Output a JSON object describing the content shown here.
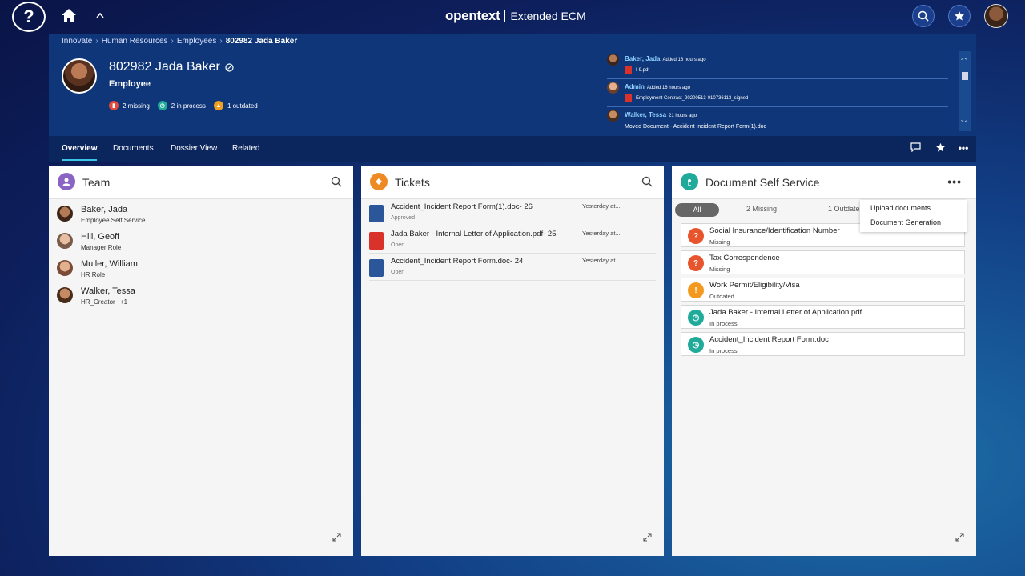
{
  "topbar": {
    "help_label": "?",
    "brand_logo": "opentext",
    "brand_product": "Extended ECM"
  },
  "breadcrumb": [
    "Innovate",
    "Human Resources",
    "Employees",
    "802982 Jada Baker"
  ],
  "person": {
    "name": "802982 Jada Baker",
    "role": "Employee",
    "status": [
      {
        "label": "2 missing",
        "color": "#e04a3a",
        "icon": "missing-icon"
      },
      {
        "label": "2 in process",
        "color": "#1faa9a",
        "icon": "clock-icon"
      },
      {
        "label": "1 outdated",
        "color": "#f0a020",
        "icon": "warning-icon"
      }
    ]
  },
  "activity": [
    {
      "who": "Baker, Jada",
      "when": "Added 16 hours ago",
      "file": "I-9.pdf"
    },
    {
      "who": "Admin",
      "when": "Added 16 hours ago",
      "file": "Employment Contract_20200513-010736113_signed"
    },
    {
      "who": "Walker, Tessa",
      "when": "21 hours ago",
      "message": "Moved Document - Accident  Incident Report Form(1).doc"
    }
  ],
  "tabs": [
    "Overview",
    "Documents",
    "Dossier View",
    "Related"
  ],
  "team": {
    "title": "Team",
    "members": [
      {
        "name": "Baker, Jada",
        "role": "Employee Self Service"
      },
      {
        "name": "Hill, Geoff",
        "role": "Manager Role"
      },
      {
        "name": "Muller, William",
        "role": "HR Role"
      },
      {
        "name": "Walker, Tessa",
        "role": "HR_Creator",
        "extra": "+1"
      }
    ]
  },
  "tickets": {
    "title": "Tickets",
    "items": [
      {
        "name": "Accident_Incident Report Form(1).doc- 26",
        "status": "Approved",
        "when": "Yesterday at...",
        "type": "word"
      },
      {
        "name": "Jada Baker - Internal Letter of Application.pdf- 25",
        "status": "Open",
        "when": "Yesterday at...",
        "type": "pdf"
      },
      {
        "name": "Accident_Incident Report Form.doc- 24",
        "status": "Open",
        "when": "Yesterday at...",
        "type": "word"
      }
    ]
  },
  "dss": {
    "title": "Document Self Service",
    "filters": [
      "All",
      "2 Missing",
      "1 Outdate"
    ],
    "menu": [
      "Upload documents",
      "Document Generation"
    ],
    "items": [
      {
        "name": "Social Insurance/Identification Number",
        "status": "Missing",
        "color": "#e8552c"
      },
      {
        "name": "Tax Correspondence",
        "status": "Missing",
        "color": "#e8552c"
      },
      {
        "name": "Work Permit/Eligibility/Visa",
        "status": "Outdated",
        "color": "#f39a1e"
      },
      {
        "name": "Jada Baker - Internal Letter of Application.pdf",
        "status": "In process",
        "color": "#1faa9a"
      },
      {
        "name": "Accident_Incident Report Form.doc",
        "status": "In process",
        "color": "#1faa9a"
      }
    ]
  }
}
